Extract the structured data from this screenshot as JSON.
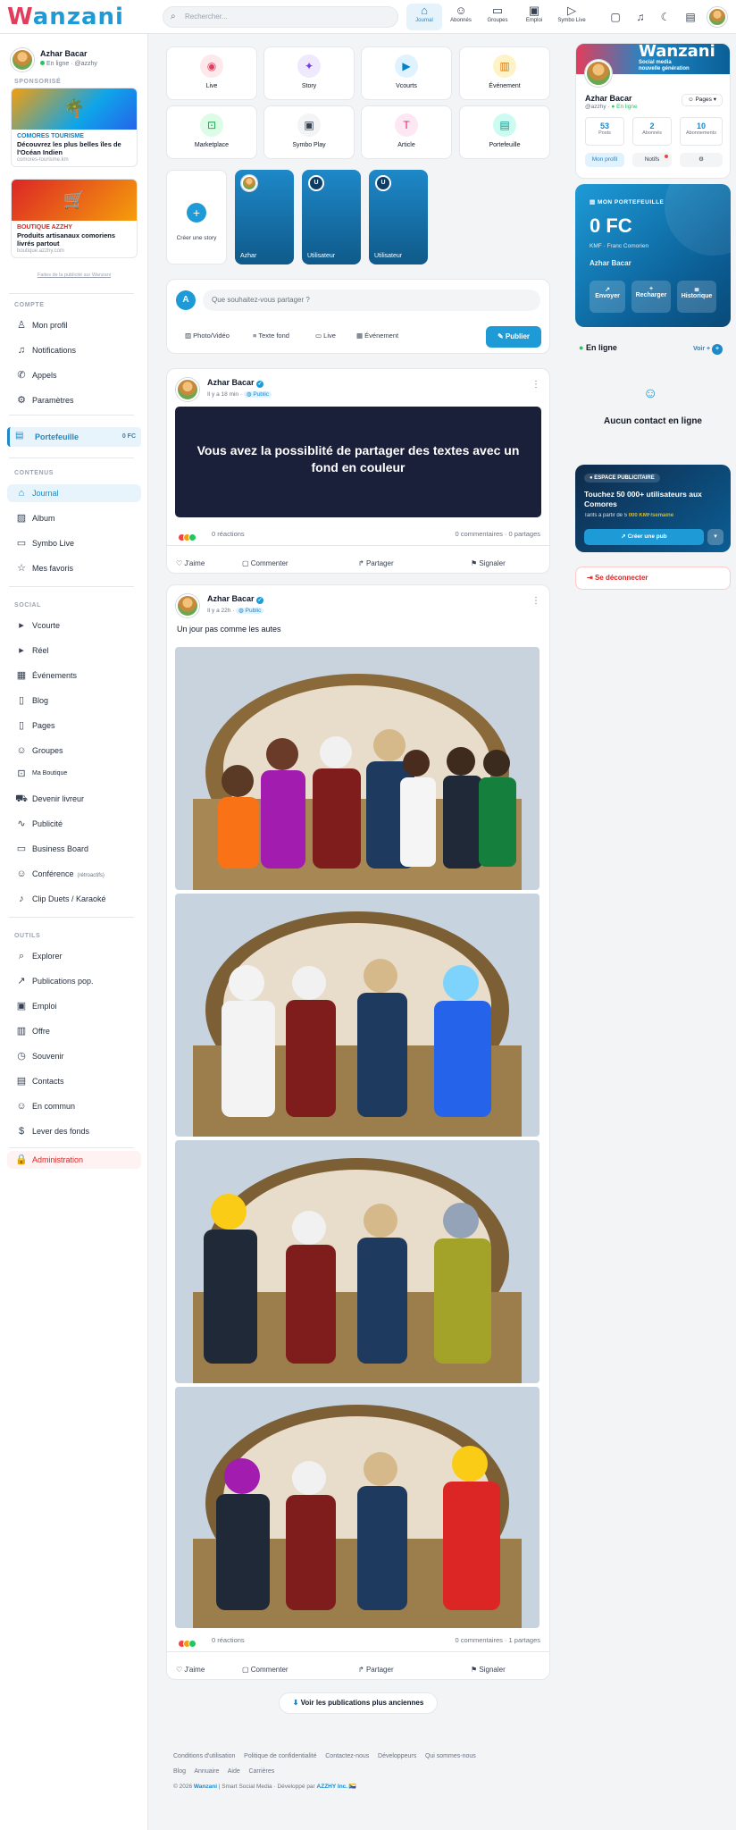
{
  "header": {
    "logo_text": "Wanzani",
    "search_placeholder": "Rechercher...",
    "nav": [
      {
        "label": "Journal",
        "icon": "home-icon"
      },
      {
        "label": "Abonnés",
        "icon": "users-icon"
      },
      {
        "label": "Groupes",
        "icon": "group-icon"
      },
      {
        "label": "Emploi",
        "icon": "briefcase-icon"
      },
      {
        "label": "Symbo Live",
        "icon": "play-icon"
      }
    ]
  },
  "profile": {
    "name": "Azhar Bacar",
    "status": "En ligne · @azzhy"
  },
  "sponsored": {
    "title": "SPONSORISÉ",
    "ads": [
      {
        "brand": "COMORES TOURISME",
        "text": "Découvrez les plus belles îles de l'Océan Indien",
        "domain": "comores-tourisme.km"
      },
      {
        "brand": "BOUTIQUE AZZHY",
        "text": "Produits artisanaux comoriens livrés partout",
        "domain": "boutique.azzhy.com"
      }
    ],
    "promo_link": "Faites de la publicité sur Wanzani"
  },
  "sidebar": {
    "compte_title": "COMPTE",
    "compte": [
      "Mon profil",
      "Notifications",
      "Appels",
      "Paramètres"
    ],
    "wallet": {
      "label": "Portefeuille",
      "amount": "0 FC"
    },
    "contenu_title": "CONTENUS",
    "contenu": [
      "Journal",
      "Album",
      "Symbo Live",
      "Mes favoris"
    ],
    "social_title": "SOCIAL",
    "social": [
      "Vcourte",
      "Réel",
      "Événements",
      "Blog",
      "Pages",
      "Groupes",
      "Ma Boutique",
      "Devenir livreur",
      "Publicité",
      "Business Board",
      "Conférence",
      "Clip Duets / Karaoké"
    ],
    "conference_tag": "(rétroactifs)",
    "outils_title": "OUTILS",
    "outils": [
      "Explorer",
      "Publications pop.",
      "Emploi",
      "Offre",
      "Souvenir",
      "Contacts",
      "En commun",
      "Lever des fonds"
    ],
    "admin": "Administration"
  },
  "quick_actions": [
    "Live",
    "Story",
    "Vcourts",
    "Événement",
    "Marketplace",
    "Symbo Play",
    "Article",
    "Portefeuille"
  ],
  "stories": {
    "create_label": "Créer une story",
    "items": [
      "Azhar",
      "Utilisateur",
      "Utilisateur"
    ],
    "initial": "U"
  },
  "composer": {
    "placeholder": "Que souhaitez-vous partager ?",
    "avatar_letter": "A",
    "actions": [
      "Photo/Vidéo",
      "Texte fond",
      "Live",
      "Événement"
    ],
    "publish": "Publier"
  },
  "posts": [
    {
      "author": "Azhar Bacar",
      "time": "Il y a 18 min",
      "visibility": "Public",
      "banner_text": "Vous avez la possiblité de partager des textes avec un fond en couleur",
      "reactions": "0 réactions",
      "stats": "0 commentaires · 0 partages"
    },
    {
      "author": "Azhar Bacar",
      "time": "Il y a 22h",
      "visibility": "Public",
      "text": "Un jour pas comme les autes",
      "reactions": "0 réactions",
      "stats": "0 commentaires · 1 partages"
    }
  ],
  "post_actions": [
    "J'aime",
    "Commenter",
    "Partager",
    "Signaler"
  ],
  "load_more": "Voir les publications plus anciennes",
  "footer": {
    "row1": [
      "Conditions d'utilisation",
      "Politique de confidentialité",
      "Contactez-nous",
      "Développeurs",
      "Qui sommes-nous"
    ],
    "row2": [
      "Blog",
      "Annuaire",
      "Aide",
      "Carrières"
    ],
    "copyright": "© 2026",
    "brand": "Wanzani",
    "middle": "| Smart Social Media · Développé par",
    "dev": "AZZHY Inc."
  },
  "right_profile": {
    "banner_title": "Wanzani",
    "banner_sub1": "Social media",
    "banner_sub2": "nouvelle génération",
    "name": "Azhar Bacar",
    "handle": "@azzhy",
    "online": "En ligne",
    "pages_btn": "Pages",
    "stats": [
      {
        "value": "53",
        "label": "Posts"
      },
      {
        "value": "2",
        "label": "Abonnés"
      },
      {
        "value": "10",
        "label": "Abonnements"
      }
    ],
    "buttons": [
      "Mon profil",
      "Notifs"
    ]
  },
  "wallet_card": {
    "title": "MON PORTEFEUILLE",
    "amount": "0 FC",
    "sub": "KMF · Franc Comorien",
    "owner": "Azhar Bacar",
    "actions": [
      "Envoyer",
      "Recharger",
      "Historique"
    ]
  },
  "online": {
    "title": "En ligne",
    "see_all": "Voir +",
    "empty": "Aucun contact en ligne"
  },
  "ad_space": {
    "tag": "ESPACE PUBLICITAIRE",
    "title": "Touchez 50 000+ utilisateurs aux Comores",
    "price_prefix": "Tarifs à partir de",
    "price": "5 000 KMF/semaine",
    "cta": "Créer une pub"
  },
  "logout": "Se déconnecter",
  "colors": {
    "brand_blue": "#1e88c8",
    "brand_red": "#e23d5c",
    "online_green": "#22c55e"
  }
}
